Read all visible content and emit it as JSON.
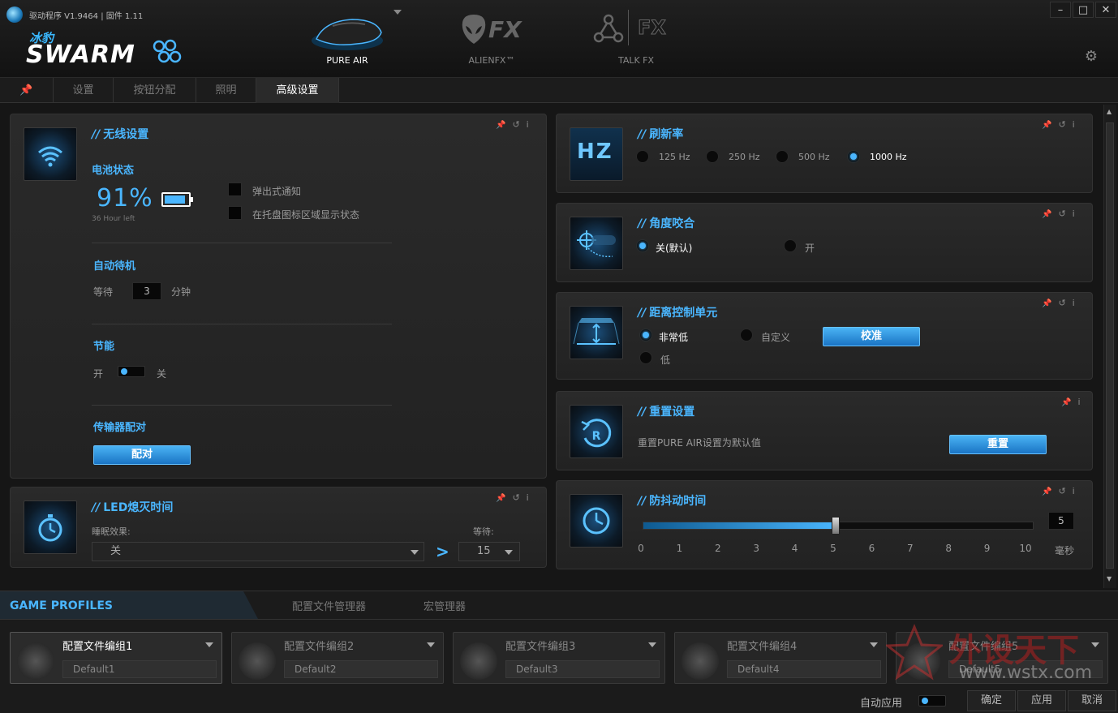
{
  "app": {
    "title": "驱动程序 V1.9464 | 固件 1.11",
    "logo_cn": "冰豹",
    "logo_text": "SWARM"
  },
  "devices": [
    {
      "label": "PURE AIR",
      "active": true
    },
    {
      "label": "ALIENFX™",
      "glyph": "FX",
      "active": false
    },
    {
      "label": "TALK FX",
      "glyph": "FX",
      "active": false
    }
  ],
  "window_controls": {
    "minimize": "–",
    "maximize": "□",
    "close": "✕"
  },
  "nav_tabs": [
    "设置",
    "按钮分配",
    "照明",
    "高级设置"
  ],
  "wireless": {
    "title": "无线设置",
    "battery_label": "电池状态",
    "battery_percent": "91%",
    "battery_level": 0.91,
    "time_left": "36 Hour left",
    "popup_notify": "弹出式通知",
    "tray_status": "在托盘图标区域显示状态",
    "auto_standby_label": "自动待机",
    "wait_label": "等待",
    "standby_minutes": "3",
    "minutes_unit": "分钟",
    "power_save_label": "节能",
    "on_label": "开",
    "off_label": "关",
    "transmitter_label": "传输器配对",
    "pair_button": "配对"
  },
  "led": {
    "title": "LED熄灭时间",
    "sleep_effect_label": "睡眠效果:",
    "sleep_effect_value": "关",
    "wait_label": "等待:",
    "wait_value": "15"
  },
  "refresh": {
    "title": "刷新率",
    "icon_text": "HZ",
    "options": [
      "125 Hz",
      "250 Hz",
      "500 Hz",
      "1000 Hz"
    ],
    "selected": 3
  },
  "angle": {
    "title": "角度咬合",
    "options": [
      "关(默认)",
      "开"
    ],
    "selected": 0
  },
  "lift": {
    "title": "距离控制单元",
    "options": [
      "非常低",
      "自定义",
      "低"
    ],
    "selected": 0,
    "calibrate_button": "校准"
  },
  "reset": {
    "title": "重置设置",
    "icon_text": "R",
    "description": "重置PURE AIR设置为默认值",
    "reset_button": "重置"
  },
  "debounce": {
    "title": "防抖动时间",
    "value": 5,
    "value_text": "5",
    "ticks": [
      "0",
      "1",
      "2",
      "3",
      "4",
      "5",
      "6",
      "7",
      "8",
      "9",
      "10"
    ],
    "unit_label": "毫秒"
  },
  "panel_tools": {
    "pin": "📌",
    "undo": "↺",
    "info": "i"
  },
  "game_profiles": {
    "title": "GAME PROFILES",
    "tabs": [
      "配置文件管理器",
      "宏管理器"
    ],
    "profiles": [
      {
        "name": "配置文件编组1",
        "default": "Default1"
      },
      {
        "name": "配置文件编组2",
        "default": "Default2"
      },
      {
        "name": "配置文件编组3",
        "default": "Default3"
      },
      {
        "name": "配置文件编组4",
        "default": "Default4"
      },
      {
        "name": "配置文件编组5",
        "default": "Default5"
      }
    ],
    "auto_apply": "自动应用",
    "ok": "确定",
    "apply": "应用",
    "cancel": "取消"
  },
  "watermark": {
    "text": "外设天下",
    "url": "www.wstx.com"
  },
  "colors": {
    "accent": "#4ab6ff",
    "background": "#161616",
    "panel": "#262626"
  }
}
